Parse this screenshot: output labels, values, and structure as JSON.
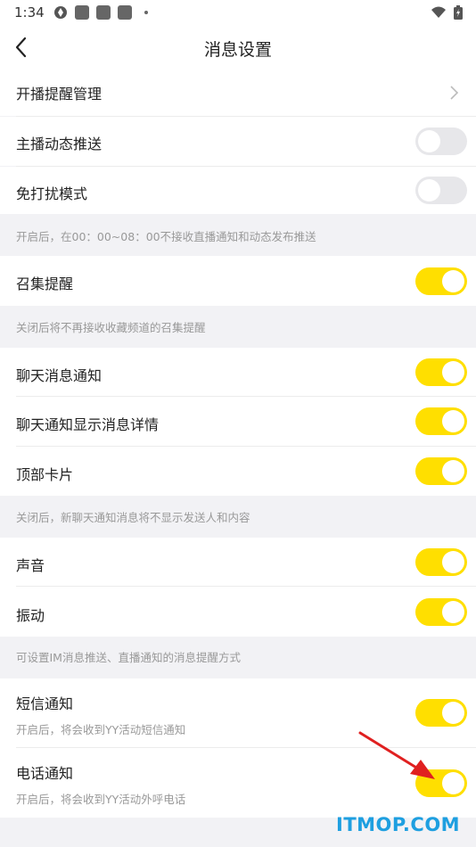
{
  "status_bar": {
    "time": "1:34"
  },
  "header": {
    "title": "消息设置"
  },
  "rows": {
    "live_reminder": {
      "label": "开播提醒管理"
    },
    "host_feed_push": {
      "label": "主播动态推送",
      "enabled": false
    },
    "do_not_disturb": {
      "label": "免打扰模式",
      "enabled": false
    },
    "gather_reminder": {
      "label": "召集提醒",
      "enabled": true
    },
    "chat_notification": {
      "label": "聊天消息通知",
      "enabled": true
    },
    "chat_detail": {
      "label": "聊天通知显示消息详情",
      "enabled": true
    },
    "top_card": {
      "label": "顶部卡片",
      "enabled": true
    },
    "sound": {
      "label": "声音",
      "enabled": true
    },
    "vibration": {
      "label": "振动",
      "enabled": true
    },
    "sms_notification": {
      "label": "短信通知",
      "sub": "开启后，将会收到YY活动短信通知",
      "enabled": true
    },
    "phone_notification": {
      "label": "电话通知",
      "sub": "开启后，将会收到YY活动外呼电话",
      "enabled": true
    }
  },
  "notes": {
    "dnd": "开启后，在00：00~08：00不接收直播通知和动态发布推送",
    "gather": "关闭后将不再接收收藏频道的召集提醒",
    "chat": "关闭后，新聊天通知消息将不显示发送人和内容",
    "sound": "可设置IM消息推送、直播通知的消息提醒方式"
  },
  "watermark": "ITMOP.COM",
  "colors": {
    "accent": "#ffdf00",
    "toggle_off": "#e7e7ea",
    "watermark": "#1e9fe0",
    "arrow": "#e02020"
  }
}
